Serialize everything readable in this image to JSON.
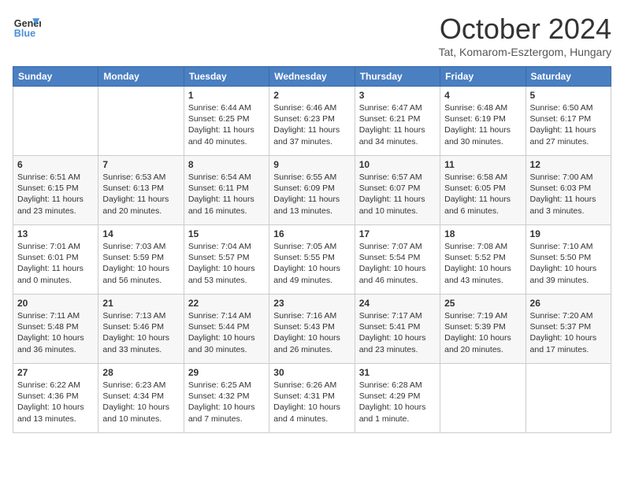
{
  "header": {
    "logo_line1": "General",
    "logo_line2": "Blue",
    "month": "October 2024",
    "location": "Tat, Komarom-Esztergom, Hungary"
  },
  "weekdays": [
    "Sunday",
    "Monday",
    "Tuesday",
    "Wednesday",
    "Thursday",
    "Friday",
    "Saturday"
  ],
  "weeks": [
    [
      {
        "day": "",
        "info": ""
      },
      {
        "day": "",
        "info": ""
      },
      {
        "day": "1",
        "info": "Sunrise: 6:44 AM\nSunset: 6:25 PM\nDaylight: 11 hours and 40 minutes."
      },
      {
        "day": "2",
        "info": "Sunrise: 6:46 AM\nSunset: 6:23 PM\nDaylight: 11 hours and 37 minutes."
      },
      {
        "day": "3",
        "info": "Sunrise: 6:47 AM\nSunset: 6:21 PM\nDaylight: 11 hours and 34 minutes."
      },
      {
        "day": "4",
        "info": "Sunrise: 6:48 AM\nSunset: 6:19 PM\nDaylight: 11 hours and 30 minutes."
      },
      {
        "day": "5",
        "info": "Sunrise: 6:50 AM\nSunset: 6:17 PM\nDaylight: 11 hours and 27 minutes."
      }
    ],
    [
      {
        "day": "6",
        "info": "Sunrise: 6:51 AM\nSunset: 6:15 PM\nDaylight: 11 hours and 23 minutes."
      },
      {
        "day": "7",
        "info": "Sunrise: 6:53 AM\nSunset: 6:13 PM\nDaylight: 11 hours and 20 minutes."
      },
      {
        "day": "8",
        "info": "Sunrise: 6:54 AM\nSunset: 6:11 PM\nDaylight: 11 hours and 16 minutes."
      },
      {
        "day": "9",
        "info": "Sunrise: 6:55 AM\nSunset: 6:09 PM\nDaylight: 11 hours and 13 minutes."
      },
      {
        "day": "10",
        "info": "Sunrise: 6:57 AM\nSunset: 6:07 PM\nDaylight: 11 hours and 10 minutes."
      },
      {
        "day": "11",
        "info": "Sunrise: 6:58 AM\nSunset: 6:05 PM\nDaylight: 11 hours and 6 minutes."
      },
      {
        "day": "12",
        "info": "Sunrise: 7:00 AM\nSunset: 6:03 PM\nDaylight: 11 hours and 3 minutes."
      }
    ],
    [
      {
        "day": "13",
        "info": "Sunrise: 7:01 AM\nSunset: 6:01 PM\nDaylight: 11 hours and 0 minutes."
      },
      {
        "day": "14",
        "info": "Sunrise: 7:03 AM\nSunset: 5:59 PM\nDaylight: 10 hours and 56 minutes."
      },
      {
        "day": "15",
        "info": "Sunrise: 7:04 AM\nSunset: 5:57 PM\nDaylight: 10 hours and 53 minutes."
      },
      {
        "day": "16",
        "info": "Sunrise: 7:05 AM\nSunset: 5:55 PM\nDaylight: 10 hours and 49 minutes."
      },
      {
        "day": "17",
        "info": "Sunrise: 7:07 AM\nSunset: 5:54 PM\nDaylight: 10 hours and 46 minutes."
      },
      {
        "day": "18",
        "info": "Sunrise: 7:08 AM\nSunset: 5:52 PM\nDaylight: 10 hours and 43 minutes."
      },
      {
        "day": "19",
        "info": "Sunrise: 7:10 AM\nSunset: 5:50 PM\nDaylight: 10 hours and 39 minutes."
      }
    ],
    [
      {
        "day": "20",
        "info": "Sunrise: 7:11 AM\nSunset: 5:48 PM\nDaylight: 10 hours and 36 minutes."
      },
      {
        "day": "21",
        "info": "Sunrise: 7:13 AM\nSunset: 5:46 PM\nDaylight: 10 hours and 33 minutes."
      },
      {
        "day": "22",
        "info": "Sunrise: 7:14 AM\nSunset: 5:44 PM\nDaylight: 10 hours and 30 minutes."
      },
      {
        "day": "23",
        "info": "Sunrise: 7:16 AM\nSunset: 5:43 PM\nDaylight: 10 hours and 26 minutes."
      },
      {
        "day": "24",
        "info": "Sunrise: 7:17 AM\nSunset: 5:41 PM\nDaylight: 10 hours and 23 minutes."
      },
      {
        "day": "25",
        "info": "Sunrise: 7:19 AM\nSunset: 5:39 PM\nDaylight: 10 hours and 20 minutes."
      },
      {
        "day": "26",
        "info": "Sunrise: 7:20 AM\nSunset: 5:37 PM\nDaylight: 10 hours and 17 minutes."
      }
    ],
    [
      {
        "day": "27",
        "info": "Sunrise: 6:22 AM\nSunset: 4:36 PM\nDaylight: 10 hours and 13 minutes."
      },
      {
        "day": "28",
        "info": "Sunrise: 6:23 AM\nSunset: 4:34 PM\nDaylight: 10 hours and 10 minutes."
      },
      {
        "day": "29",
        "info": "Sunrise: 6:25 AM\nSunset: 4:32 PM\nDaylight: 10 hours and 7 minutes."
      },
      {
        "day": "30",
        "info": "Sunrise: 6:26 AM\nSunset: 4:31 PM\nDaylight: 10 hours and 4 minutes."
      },
      {
        "day": "31",
        "info": "Sunrise: 6:28 AM\nSunset: 4:29 PM\nDaylight: 10 hours and 1 minute."
      },
      {
        "day": "",
        "info": ""
      },
      {
        "day": "",
        "info": ""
      }
    ]
  ]
}
